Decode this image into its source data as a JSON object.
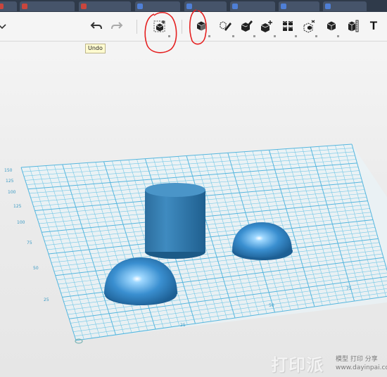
{
  "browser": {
    "tabs": [
      {
        "label": "",
        "color": "#c9463d"
      },
      {
        "label": "",
        "color": "#c9463d"
      },
      {
        "label": "",
        "color": "#c9463d"
      },
      {
        "label": "",
        "color": "#4f7fd6"
      },
      {
        "label": "",
        "color": "#4f7fd6"
      },
      {
        "label": "",
        "color": "#4f7fd6"
      },
      {
        "label": "",
        "color": "#4f7fd6"
      },
      {
        "label": "",
        "color": "#4f7fd6"
      }
    ]
  },
  "toolbar": {
    "menu_icon": "chevron-down-icon",
    "undo_icon": "undo-arrow-icon",
    "redo_icon": "redo-arrow-icon",
    "tools": [
      {
        "name": "sketch-plane-icon"
      },
      {
        "name": "primitive-box-icon"
      },
      {
        "name": "sketch-pencil-icon"
      },
      {
        "name": "construct-icon"
      },
      {
        "name": "modify-icon"
      },
      {
        "name": "pattern-icon"
      },
      {
        "name": "group-icon"
      },
      {
        "name": "combine-icon"
      },
      {
        "name": "measure-icon"
      },
      {
        "name": "text-icon"
      }
    ],
    "text_tool_glyph": "T"
  },
  "tooltip": {
    "text": "Undo"
  },
  "viewport": {
    "grid_color": "#6cc7e8",
    "object_color": "#3a8fc7",
    "objects": [
      "cylinder",
      "hemisphere",
      "hemisphere"
    ],
    "left_axis_ticks": [
      "150",
      "125",
      "100",
      "125",
      "100",
      "75",
      "50",
      "25"
    ],
    "bottom_axis_ticks": [
      "25",
      "50",
      "75"
    ]
  },
  "watermark": {
    "big": "打印派",
    "small1": "模型 打印 分享",
    "small2": "www.dayinpai.com"
  }
}
